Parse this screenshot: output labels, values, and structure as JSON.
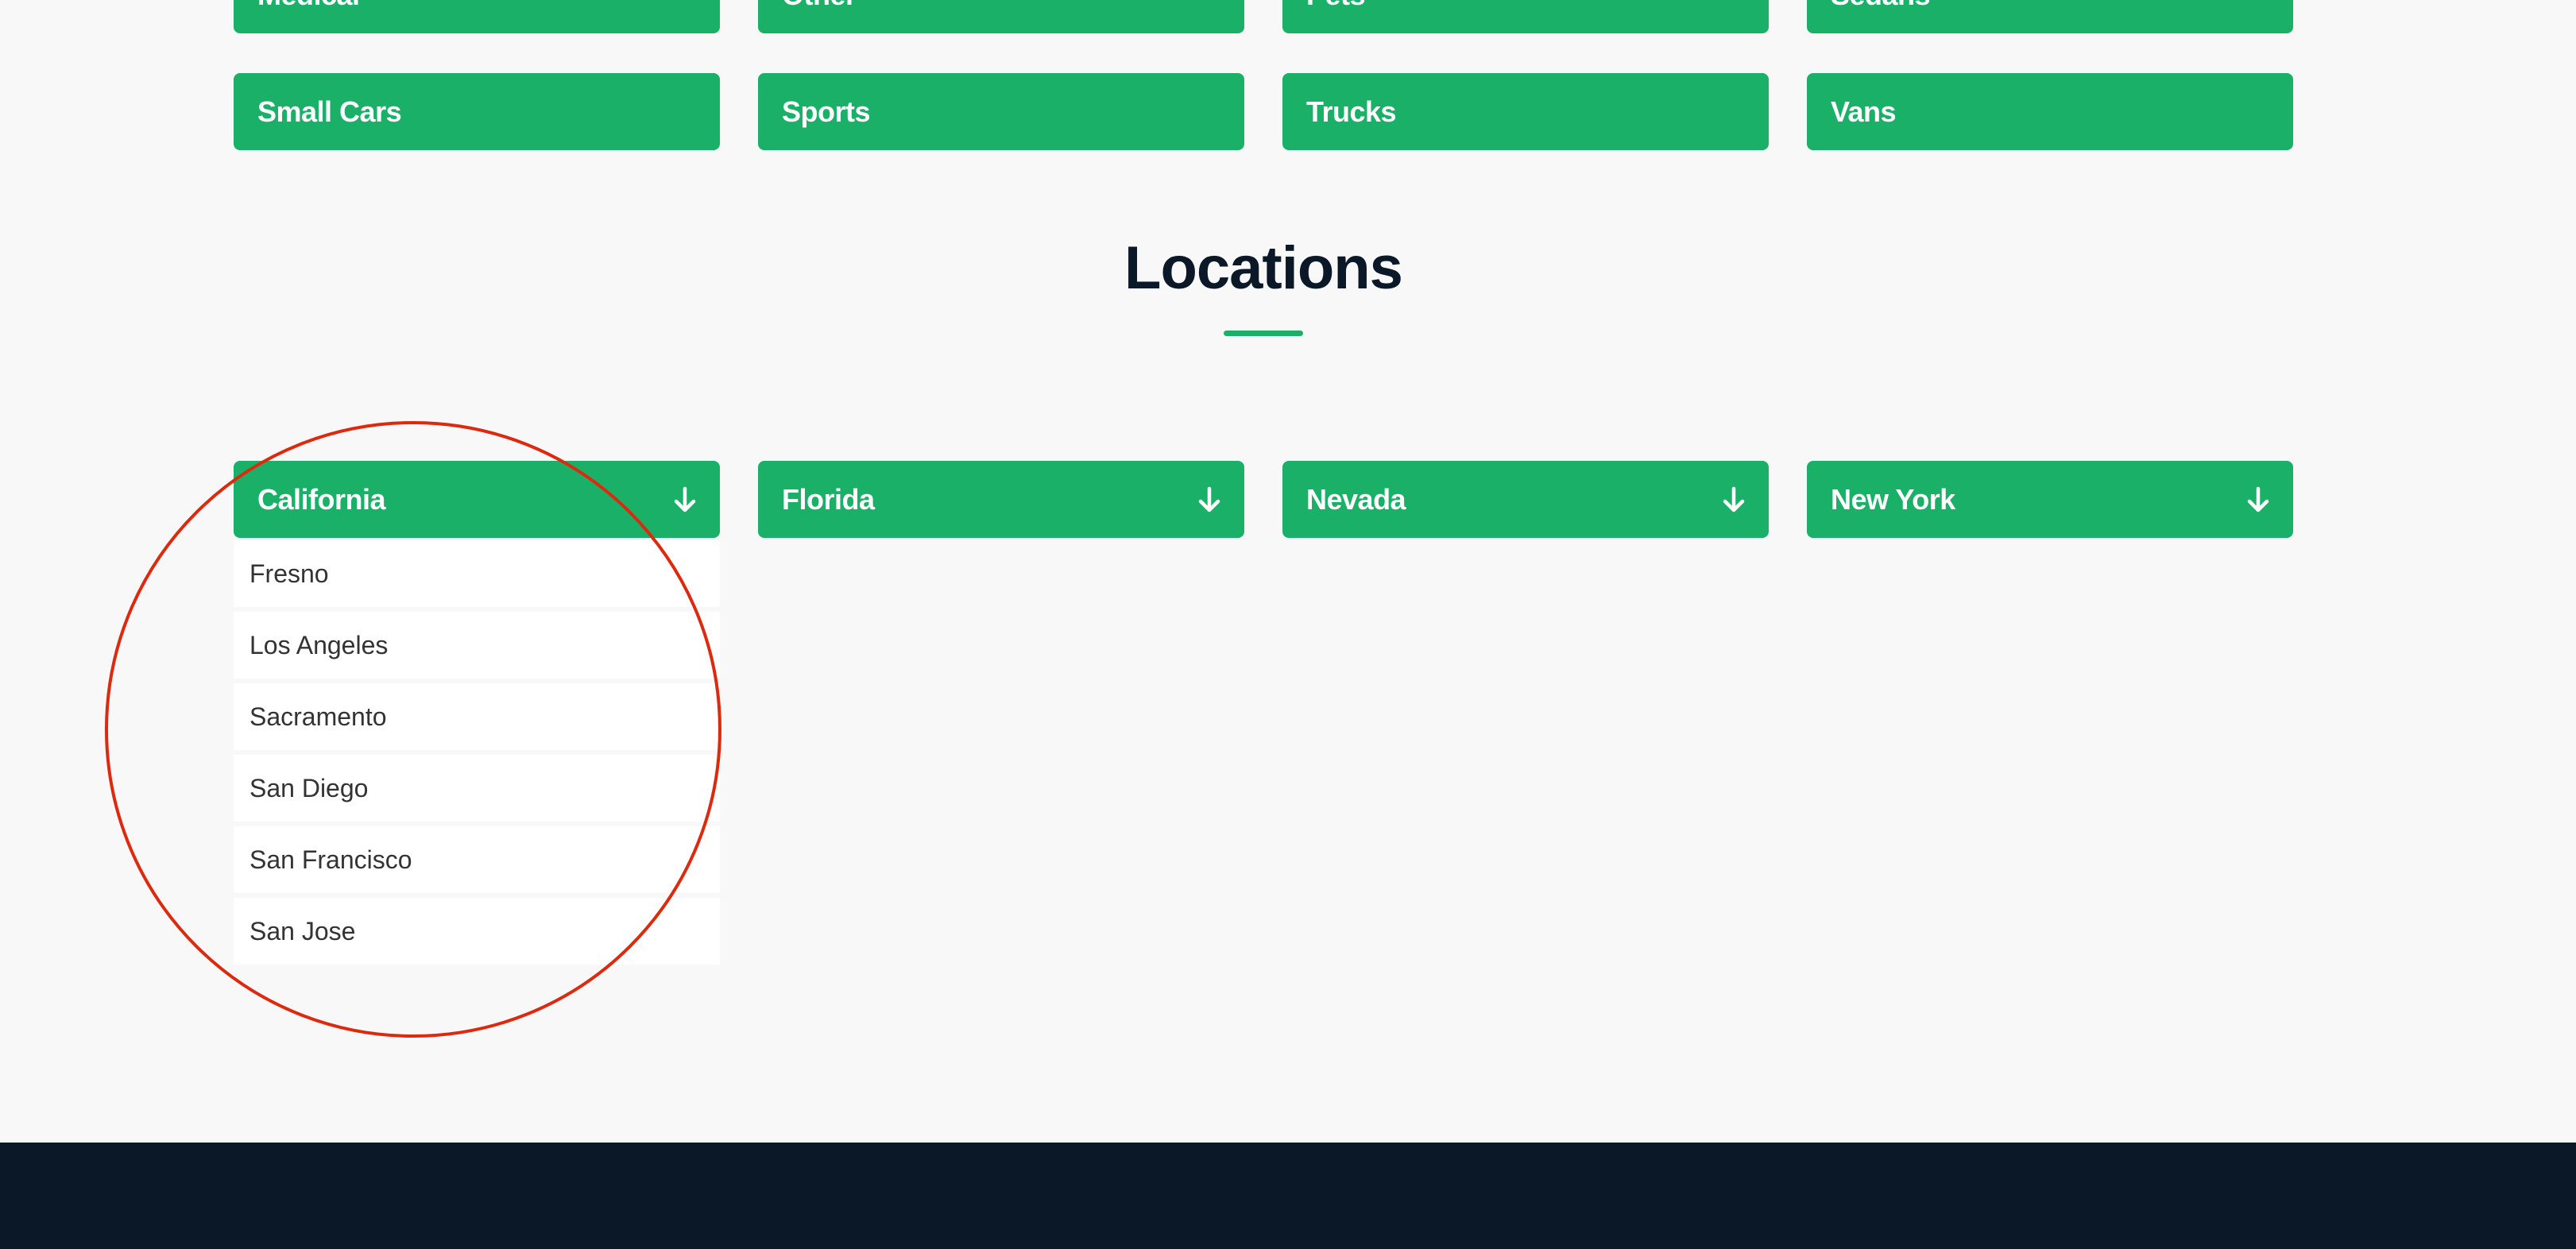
{
  "theme": {
    "accent": "#1bb068",
    "background": "#f8f8f8",
    "footer": "#0a1828",
    "title_color": "#0a1828",
    "annotation": "#dd2a0e"
  },
  "categories": {
    "row1": [
      {
        "label": "Medical"
      },
      {
        "label": "Other"
      },
      {
        "label": "Pets"
      },
      {
        "label": "Sedans"
      }
    ],
    "row2": [
      {
        "label": "Small Cars"
      },
      {
        "label": "Sports"
      },
      {
        "label": "Trucks"
      },
      {
        "label": "Vans"
      }
    ]
  },
  "locations": {
    "title": "Locations",
    "states": [
      {
        "label": "California",
        "icon": "arrow-down-icon",
        "expanded": true,
        "cities": [
          "Fresno",
          "Los Angeles",
          "Sacramento",
          "San Diego",
          "San Francisco",
          "San Jose"
        ]
      },
      {
        "label": "Florida",
        "icon": "arrow-down-icon",
        "expanded": false
      },
      {
        "label": "Nevada",
        "icon": "arrow-down-icon",
        "expanded": false
      },
      {
        "label": "New York",
        "icon": "arrow-down-icon",
        "expanded": false
      }
    ]
  }
}
